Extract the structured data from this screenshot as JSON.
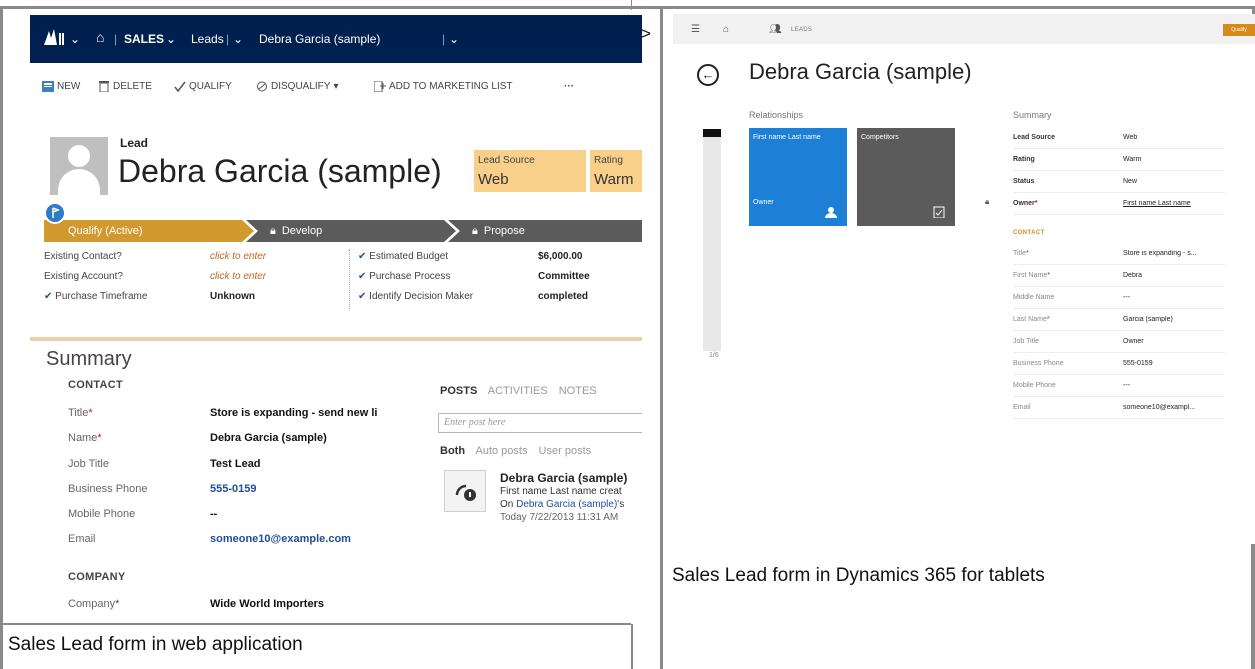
{
  "web": {
    "nav": {
      "home_label": "⌂",
      "sales_label": "SALES",
      "sales_caret": "⌄",
      "leads_label": "Leads",
      "record_label": "Debra Garcia (sample)",
      "record_caret": "⌄"
    },
    "commands": {
      "new": "NEW",
      "delete": "DELETE",
      "qualify": "QUALIFY",
      "disqualify": "DISQUALIFY",
      "add_to_marketing": "ADD TO MARKETING LIST",
      "more": "···"
    },
    "header": {
      "entity": "Lead",
      "name": "Debra Garcia (sample)",
      "lead_source_label": "Lead Source",
      "lead_source_value": "Web",
      "rating_label": "Rating",
      "rating_value": "Warm"
    },
    "process": {
      "stage1": "Qualify (Active)",
      "stage2": "Develop",
      "stage3": "Propose"
    },
    "steps": {
      "existing_contact_label": "Existing Contact?",
      "existing_contact_value": "click to enter",
      "existing_account_label": "Existing Account?",
      "existing_account_value": "click to enter",
      "purchase_timeframe_label": "Purchase Timeframe",
      "purchase_timeframe_value": "Unknown",
      "estimated_budget_label": "Estimated Budget",
      "estimated_budget_value": "$6,000.00",
      "purchase_process_label": "Purchase Process",
      "purchase_process_value": "Committee",
      "decision_maker_label": "Identify Decision Maker",
      "decision_maker_value": "completed"
    },
    "summary": {
      "title": "Summary",
      "contact_heading": "CONTACT",
      "fields": [
        {
          "label": "Title",
          "value": "Store is expanding - send new li"
        },
        {
          "label": "Name",
          "value": "Debra Garcia (sample)"
        },
        {
          "label": "Job Title",
          "value": "Test Lead"
        },
        {
          "label": "Business Phone",
          "value": "555-0159"
        },
        {
          "label": "Mobile Phone",
          "value": "--"
        },
        {
          "label": "Email",
          "value": "someone10@example.com"
        }
      ],
      "company_heading": "COMPANY",
      "company_label": "Company",
      "company_value": "Wide World Importers"
    },
    "posts": {
      "tab_posts": "POSTS",
      "tab_activities": "ACTIVITIES",
      "tab_notes": "NOTES",
      "input_placeholder": "Enter post here",
      "filter_both": "Both",
      "filter_auto": "Auto posts",
      "filter_user": "User posts",
      "post_title": "Debra Garcia (sample)",
      "post_line1": "First name Last name creat",
      "post_line2_prefix": "On ",
      "post_line2_link": "Debra Garcia (sample)",
      "post_line2_suffix": "'s",
      "post_date": "Today 7/22/2013 11:31 AM"
    },
    "caption": "Sales Lead form in web application"
  },
  "tablet": {
    "leads_label": "LEADS",
    "qualify_label": "Qualify",
    "name": "Debra Garcia (sample)",
    "relationships_label": "Relationships",
    "tile1_title": "First name Last name",
    "tile1_bottom": "Owner",
    "tile2_title": "Competitors",
    "scroll_label": "1/6",
    "summary_label": "Summary",
    "top_rows": [
      {
        "label": "Lead Source",
        "value": "Web"
      },
      {
        "label": "Rating",
        "value": "Warm"
      },
      {
        "label": "Status",
        "value": "New"
      },
      {
        "label": "Owner",
        "value": "First name Last name"
      }
    ],
    "contact_heading": "CONTACT",
    "contact_rows": [
      {
        "label": "Title",
        "value": "Store is expanding - s..."
      },
      {
        "label": "First Name",
        "value": "Debra"
      },
      {
        "label": "Middle Name",
        "value": "---"
      },
      {
        "label": "Last Name",
        "value": "Garcia (sample)"
      },
      {
        "label": "Job Title",
        "value": "Owner"
      },
      {
        "label": "Business Phone",
        "value": "555-0159"
      },
      {
        "label": "Mobile Phone",
        "value": "---"
      },
      {
        "label": "Email",
        "value": "someone10@exampl..."
      }
    ],
    "caption": "Sales Lead form in Dynamics 365 for tablets"
  },
  "separator": ">",
  "colors": {
    "navbar": "#002050",
    "process_active": "#d29a2e",
    "process_inactive": "#5b5b5b",
    "header_field": "#f8d08a",
    "tile_blue": "#1e7fd6",
    "tile_gray": "#5b5b5b",
    "tablet_accent": "#d68a1a"
  }
}
